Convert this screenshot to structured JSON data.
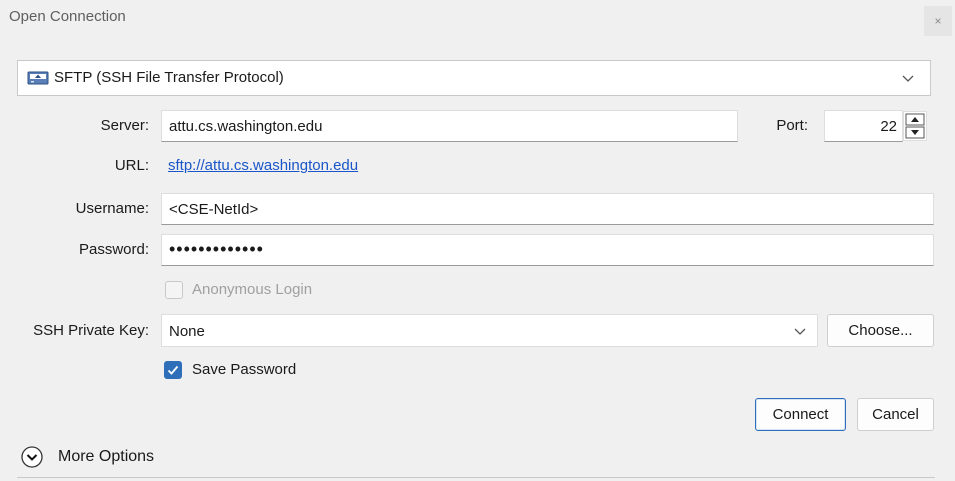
{
  "window": {
    "title": "Open Connection",
    "close_glyph": "×"
  },
  "protocol": {
    "icon": "sftp-drive-icon",
    "selected": "SFTP (SSH File Transfer Protocol)"
  },
  "server": {
    "label": "Server:",
    "value": "attu.cs.washington.edu"
  },
  "port": {
    "label": "Port:",
    "value": "22"
  },
  "url": {
    "label": "URL:",
    "value": "sftp://attu.cs.washington.edu"
  },
  "username": {
    "label": "Username:",
    "value": "<CSE-NetId>"
  },
  "password": {
    "label": "Password:",
    "value": "•••••••••••••"
  },
  "anonymous_login": {
    "label": "Anonymous Login",
    "checked": false,
    "enabled": false
  },
  "ssh_key": {
    "label": "SSH Private Key:",
    "selected": "None",
    "choose_label": "Choose..."
  },
  "save_password": {
    "label": "Save Password",
    "checked": true
  },
  "buttons": {
    "connect": "Connect",
    "cancel": "Cancel"
  },
  "more_options": {
    "label": "More Options"
  },
  "colors": {
    "accent": "#2f6fb9",
    "link": "#1a56c9",
    "background": "#f0f0f0"
  }
}
